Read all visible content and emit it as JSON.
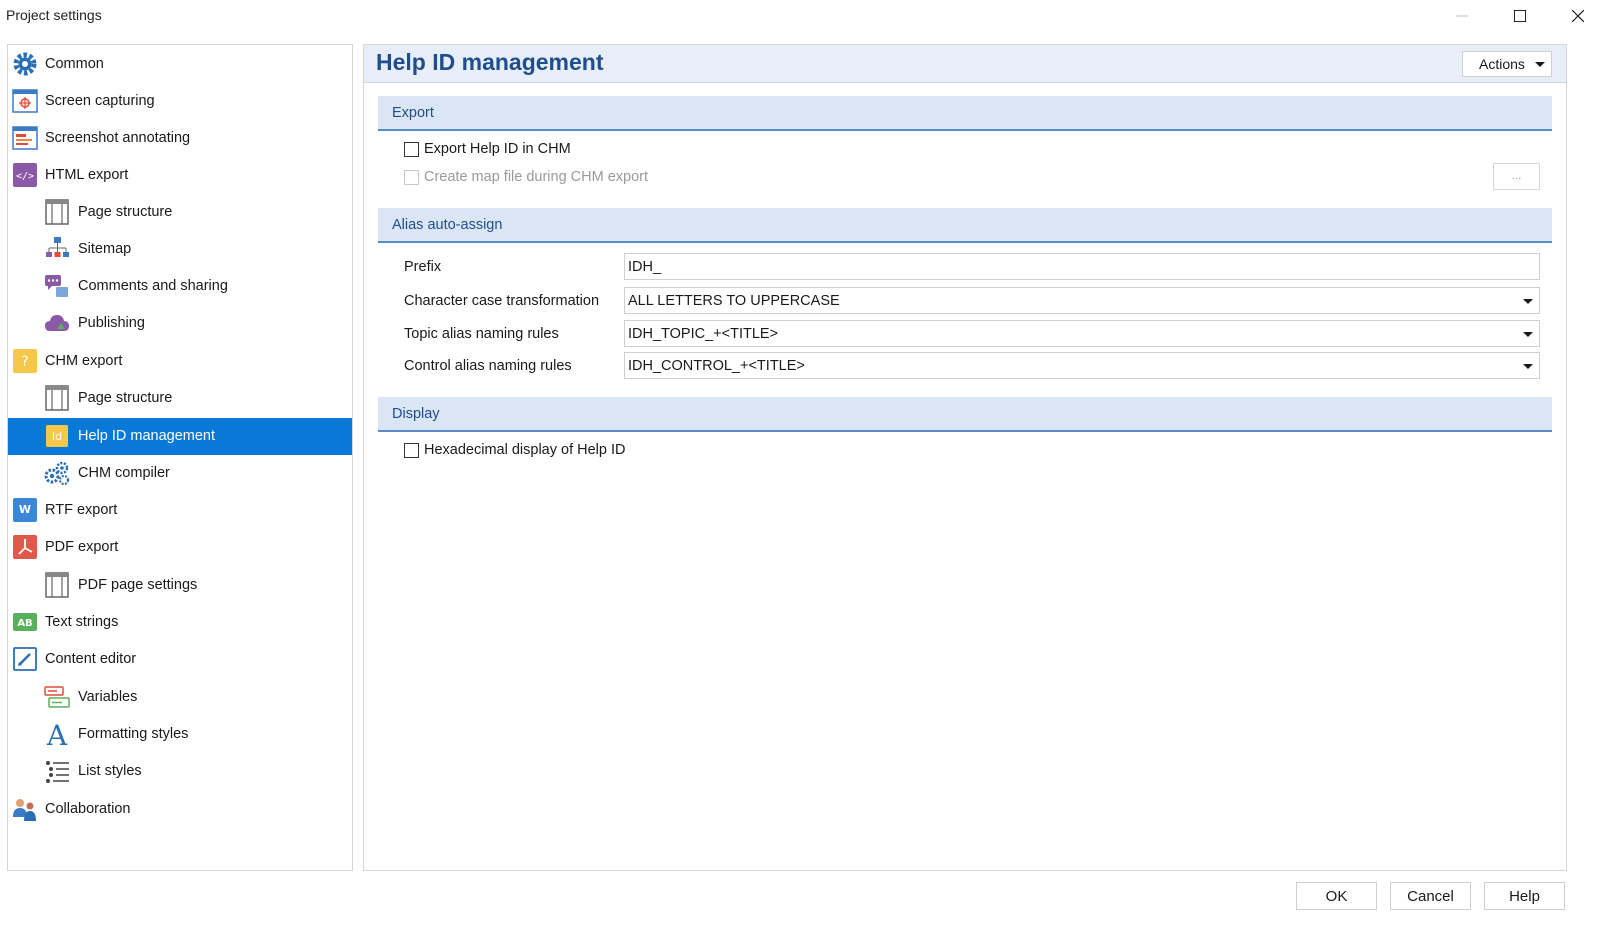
{
  "window": {
    "title": "Project settings"
  },
  "sidebar": {
    "items": [
      {
        "label": "Common",
        "icon": "gear-icon"
      },
      {
        "label": "Screen capturing",
        "icon": "screen-capture-icon"
      },
      {
        "label": "Screenshot annotating",
        "icon": "annotate-icon"
      },
      {
        "label": "HTML export",
        "icon": "html-icon"
      },
      {
        "label": "Page structure",
        "icon": "page-structure-icon"
      },
      {
        "label": "Sitemap",
        "icon": "sitemap-icon"
      },
      {
        "label": "Comments and sharing",
        "icon": "comments-icon"
      },
      {
        "label": "Publishing",
        "icon": "cloud-icon"
      },
      {
        "label": "CHM export",
        "icon": "chm-icon"
      },
      {
        "label": "Page structure",
        "icon": "page-structure-icon"
      },
      {
        "label": "Help ID management",
        "icon": "id-icon"
      },
      {
        "label": "CHM compiler",
        "icon": "gears-icon"
      },
      {
        "label": "RTF export",
        "icon": "word-icon"
      },
      {
        "label": "PDF export",
        "icon": "pdf-icon"
      },
      {
        "label": "PDF page settings",
        "icon": "page-structure-icon"
      },
      {
        "label": "Text strings",
        "icon": "ab-icon"
      },
      {
        "label": "Content editor",
        "icon": "edit-icon"
      },
      {
        "label": "Variables",
        "icon": "variables-icon"
      },
      {
        "label": "Formatting styles",
        "icon": "font-a-icon"
      },
      {
        "label": "List styles",
        "icon": "list-icon"
      },
      {
        "label": "Collaboration",
        "icon": "collaboration-icon"
      }
    ],
    "selected": "Help ID management"
  },
  "main": {
    "title": "Help ID management",
    "actions_label": "Actions",
    "sections": {
      "export": {
        "title": "Export",
        "export_help_id": "Export Help ID in CHM",
        "create_map_file": "Create map file during CHM export",
        "browse_label": "..."
      },
      "alias": {
        "title": "Alias auto-assign",
        "prefix_label": "Prefix",
        "prefix_value": "IDH_",
        "case_label": "Character case transformation",
        "case_value": "ALL LETTERS TO UPPERCASE",
        "topic_label": "Topic alias naming rules",
        "topic_value": "IDH_TOPIC_+<TITLE>",
        "control_label": "Control alias naming rules",
        "control_value": "IDH_CONTROL_+<TITLE>"
      },
      "display": {
        "title": "Display",
        "hexadecimal": "Hexadecimal display of Help ID"
      }
    }
  },
  "footer": {
    "ok": "OK",
    "cancel": "Cancel",
    "help": "Help"
  },
  "colors": {
    "selection": "#0a78d7",
    "section_bg": "#dbe6f4",
    "section_text": "#1f4e8c",
    "header_bg": "#e8eef7"
  }
}
